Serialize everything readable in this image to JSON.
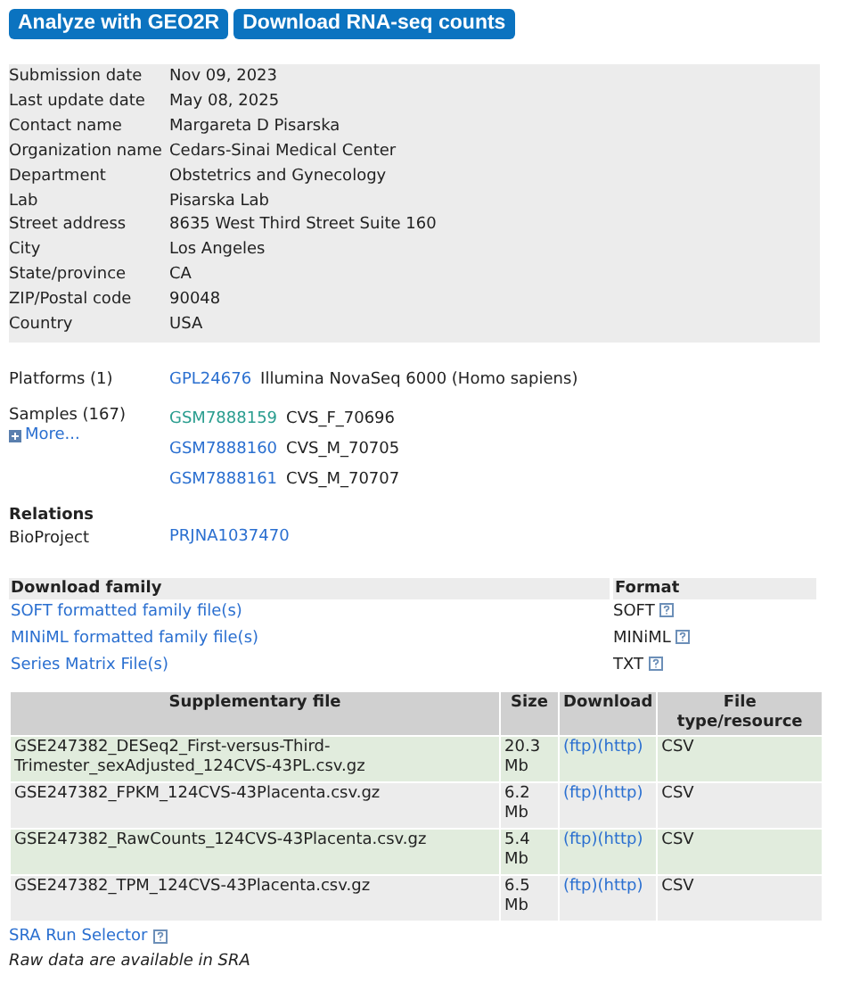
{
  "actions": [
    "Analyze with GEO2R",
    "Download RNA-seq counts"
  ],
  "contact": [
    {
      "label": "Submission date",
      "value": "Nov 09, 2023"
    },
    {
      "label": "Last update date",
      "value": "May 08, 2025"
    },
    {
      "label": "Contact name",
      "value": "Margareta D Pisarska"
    },
    {
      "label": "Organization name",
      "value": "Cedars-Sinai Medical Center"
    },
    {
      "label": "Department",
      "value": "Obstetrics and Gynecology"
    },
    {
      "label": "Lab",
      "value": "Pisarska Lab"
    },
    {
      "label": "Street address",
      "value": "8635 West Third Street Suite 160"
    },
    {
      "label": "City",
      "value": "Los Angeles"
    },
    {
      "label": "State/province",
      "value": "CA"
    },
    {
      "label": "ZIP/Postal code",
      "value": "90048"
    },
    {
      "label": "Country",
      "value": "USA"
    }
  ],
  "platforms": {
    "label": "Platforms (1)",
    "items": [
      {
        "accession": "GPL24676",
        "title": "Illumina NovaSeq 6000 (Homo sapiens)"
      }
    ]
  },
  "samples": {
    "label": "Samples (167)",
    "more": "More...",
    "items": [
      {
        "accession": "GSM7888159",
        "title": "CVS_F_70696",
        "visited": true
      },
      {
        "accession": "GSM7888160",
        "title": "CVS_M_70705",
        "visited": false
      },
      {
        "accession": "GSM7888161",
        "title": "CVS_M_70707",
        "visited": false
      }
    ]
  },
  "relations": {
    "heading": "Relations",
    "label": "BioProject",
    "value": "PRJNA1037470"
  },
  "download_family": {
    "columns": [
      "Download family",
      "Format"
    ],
    "rows": [
      {
        "file": "SOFT formatted family file(s)",
        "format": "SOFT"
      },
      {
        "file": "MINiML formatted family file(s)",
        "format": "MINiML"
      },
      {
        "file": "Series Matrix File(s)",
        "format": "TXT"
      }
    ]
  },
  "supplementary": {
    "columns": [
      "Supplementary file",
      "Size",
      "Download",
      "File type/resource"
    ],
    "rows": [
      {
        "file": "GSE247382_DESeq2_First-versus-Third-Trimester_sexAdjusted_124CVS-43PL.csv.gz",
        "size": "20.3 Mb",
        "links": [
          "(ftp)",
          "(http)"
        ],
        "type": "CSV"
      },
      {
        "file": "GSE247382_FPKM_124CVS-43Placenta.csv.gz",
        "size": "6.2 Mb",
        "links": [
          "(ftp)",
          "(http)"
        ],
        "type": "CSV"
      },
      {
        "file": "GSE247382_RawCounts_124CVS-43Placenta.csv.gz",
        "size": "5.4 Mb",
        "links": [
          "(ftp)",
          "(http)"
        ],
        "type": "CSV"
      },
      {
        "file": "GSE247382_TPM_124CVS-43Placenta.csv.gz",
        "size": "6.5 Mb",
        "links": [
          "(ftp)",
          "(http)"
        ],
        "type": "CSV"
      }
    ]
  },
  "sra_link": "SRA Run Selector",
  "raw_note": "Raw data are available in SRA"
}
